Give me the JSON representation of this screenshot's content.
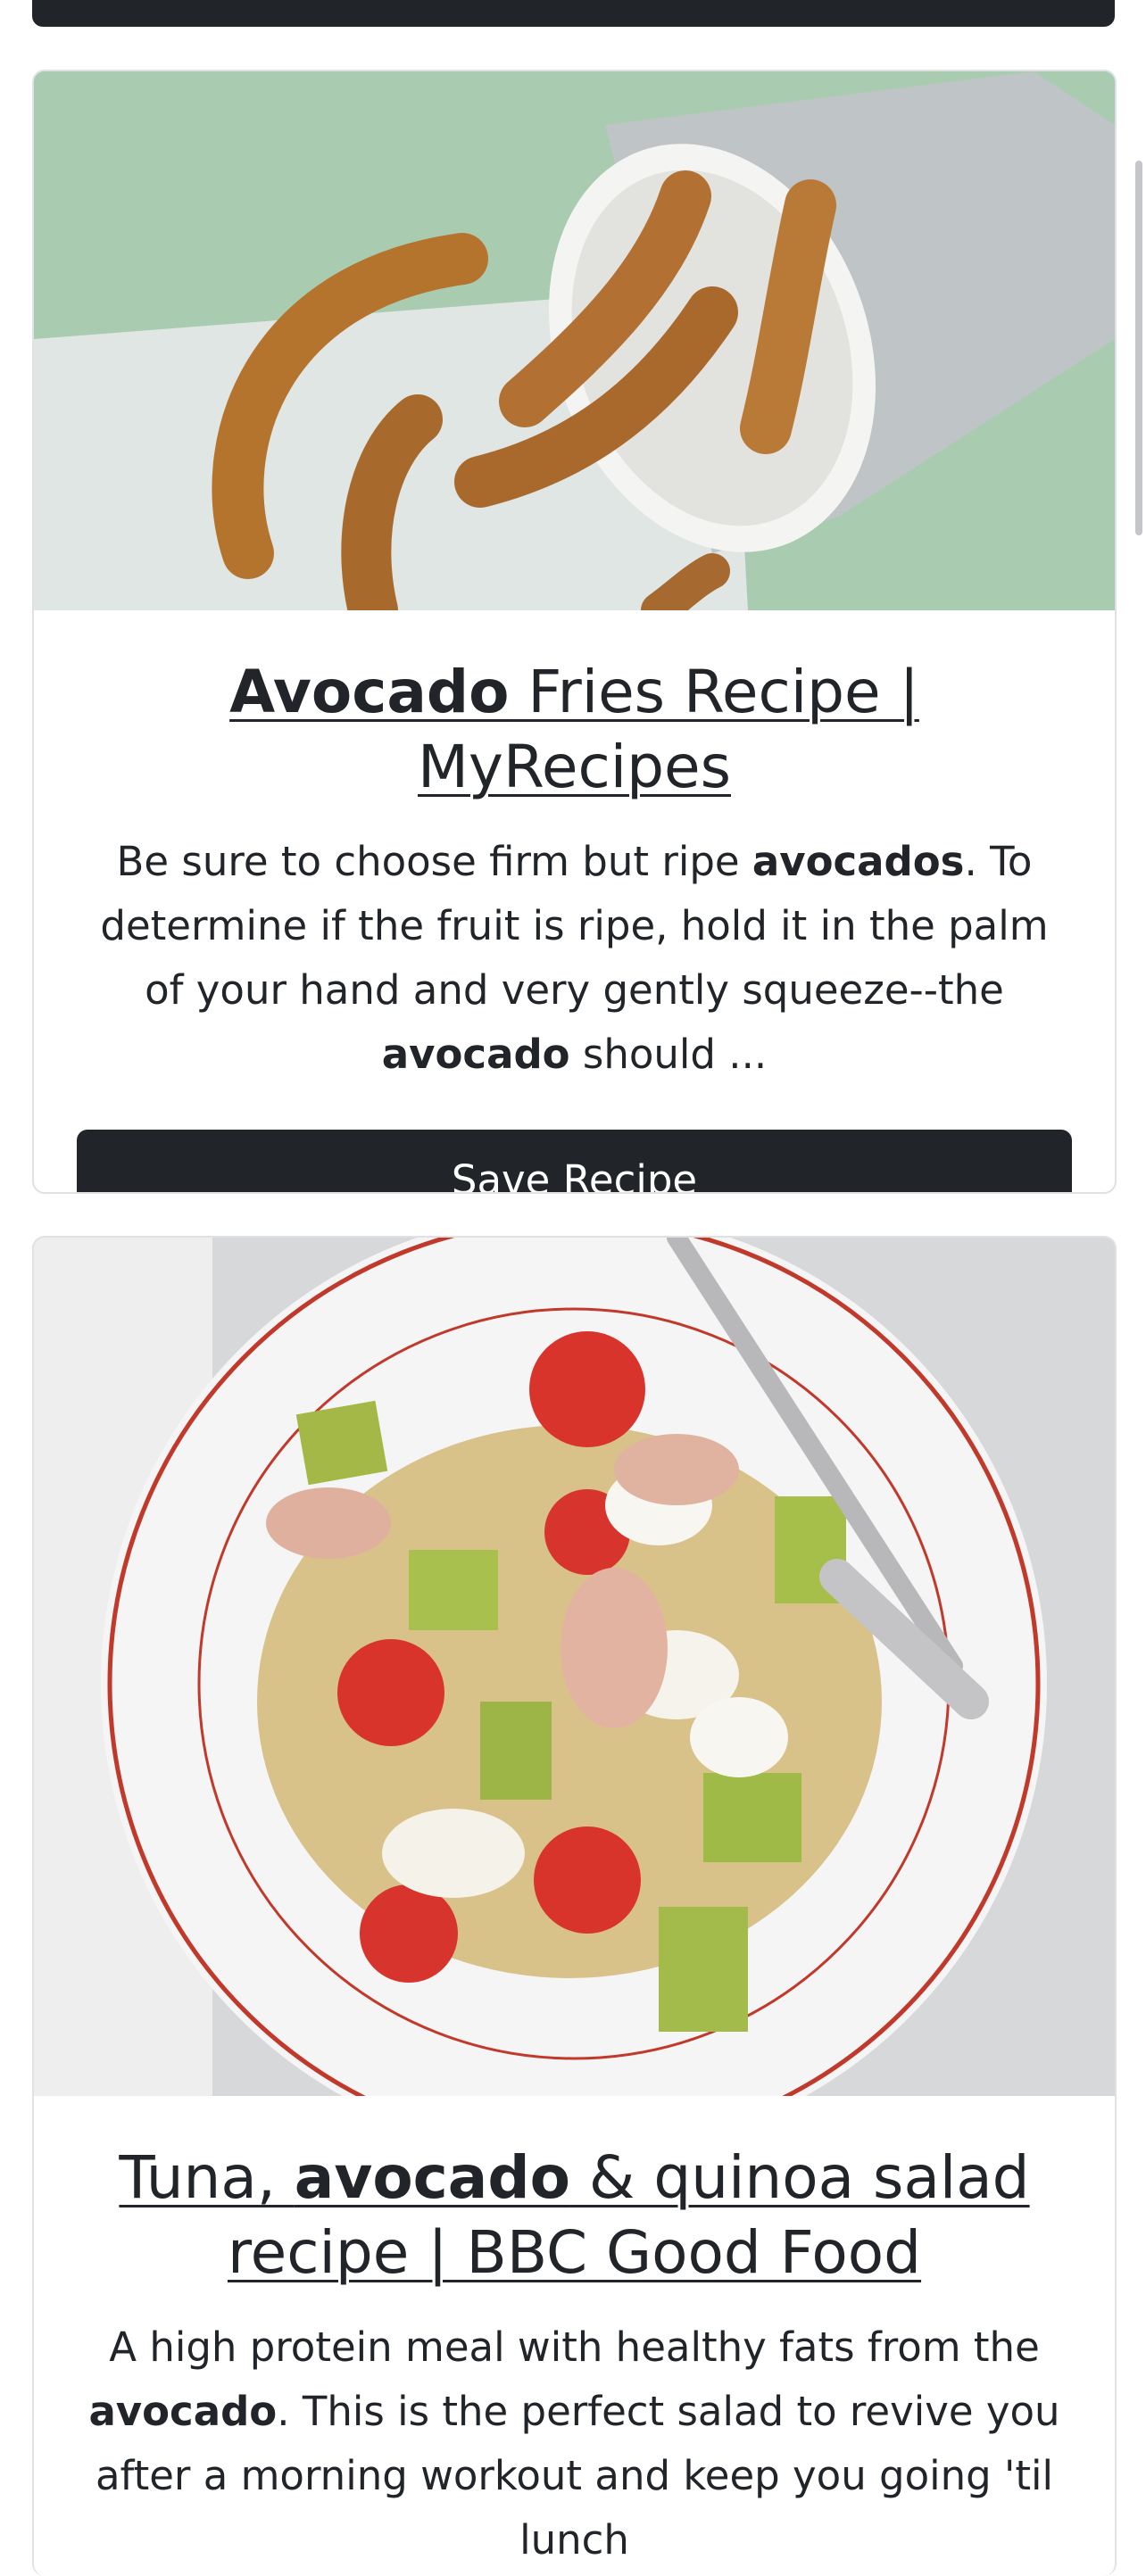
{
  "results": [
    {
      "title_parts": [
        "Avocado",
        " Fries Recipe | MyRecipes"
      ],
      "snippet_parts": [
        "Be sure to choose firm but ripe ",
        "avocados",
        ". To determine if the fruit is ripe, hold it in the palm of your hand and very gently squeeze--the ",
        "avocado",
        " should ..."
      ],
      "save_label": "Save Recipe",
      "image_alt": "avocado-fries-photo"
    },
    {
      "title_parts": [
        "Tuna, ",
        "avocado",
        " & quinoa salad recipe | BBC Good Food"
      ],
      "snippet_parts": [
        "A high protein meal with healthy fats from the ",
        "avocado",
        ". This is the perfect salad to revive you after a morning workout and keep you going 'til lunch"
      ],
      "image_alt": "tuna-avocado-quinoa-salad-photo"
    }
  ],
  "colors": {
    "button_bg": "#212529",
    "button_text": "#ffffff",
    "card_border": "#dfe1e4",
    "text": "#212529"
  }
}
